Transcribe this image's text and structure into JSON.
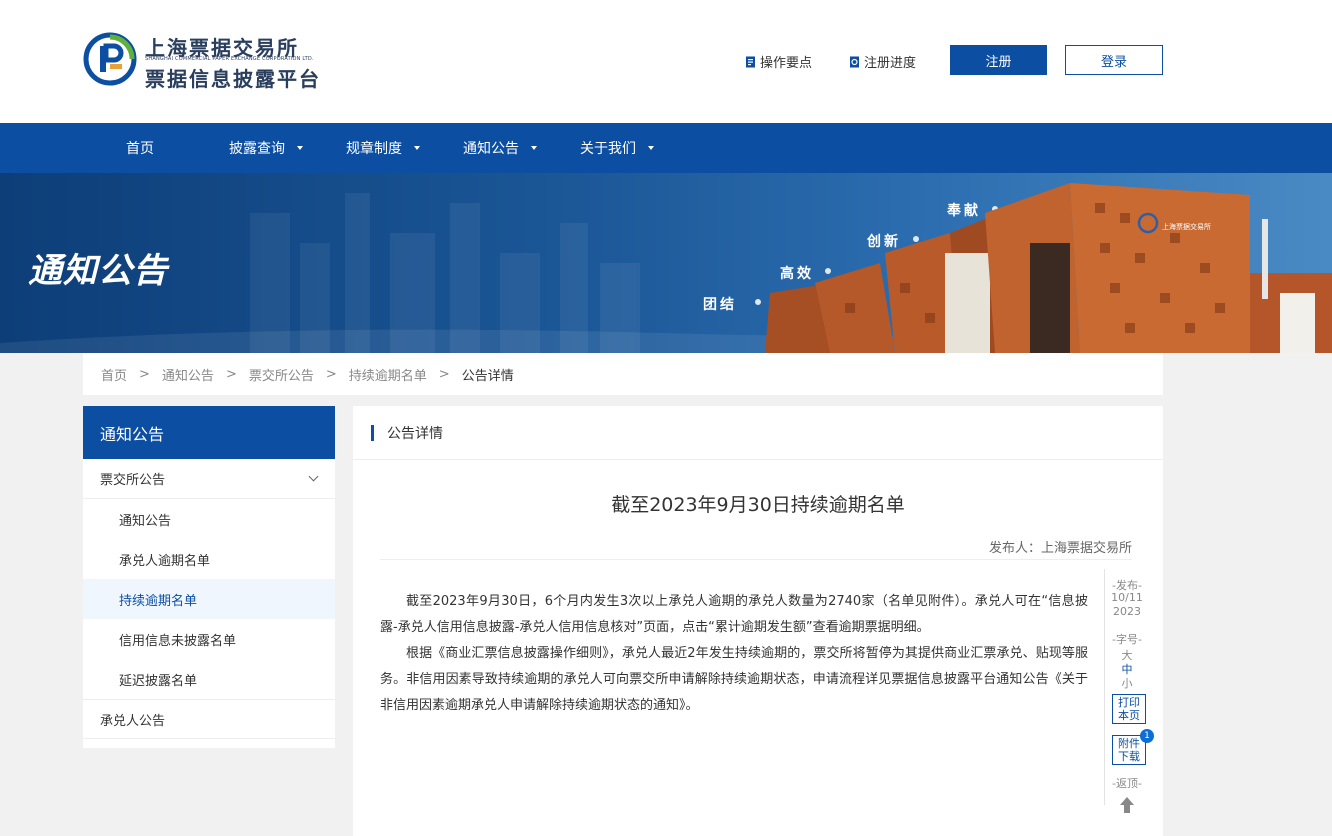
{
  "header": {
    "logo": {
      "title": "上海票据交易所",
      "subtitle_en": "SHANGHAI COMMERCIAL PAPER EXCHANGE CORPORATION LTD.",
      "platform": "票据信息披露平台"
    },
    "links": [
      {
        "label": "操作要点",
        "icon": "document-icon"
      },
      {
        "label": "注册进度",
        "icon": "progress-icon"
      }
    ],
    "register_label": "注册",
    "login_label": "登录"
  },
  "nav": {
    "items": [
      {
        "label": "首页",
        "has_dropdown": false
      },
      {
        "label": "披露查询",
        "has_dropdown": true
      },
      {
        "label": "规章制度",
        "has_dropdown": true
      },
      {
        "label": "通知公告",
        "has_dropdown": true
      },
      {
        "label": "关于我们",
        "has_dropdown": true
      }
    ]
  },
  "banner": {
    "title": "通知公告",
    "words": [
      "团结",
      "高效",
      "创新",
      "奉献"
    ],
    "building_sign": "上海票据交易所"
  },
  "breadcrumb": {
    "items": [
      "首页",
      "通知公告",
      "票交所公告",
      "持续逾期名单",
      "公告详情"
    ],
    "separator": ">"
  },
  "sidebar": {
    "title": "通知公告",
    "category": "票交所公告",
    "items": [
      {
        "label": "通知公告",
        "active": false
      },
      {
        "label": "承兑人逾期名单",
        "active": false
      },
      {
        "label": "持续逾期名单",
        "active": true
      },
      {
        "label": "信用信息未披露名单",
        "active": false
      },
      {
        "label": "延迟披露名单",
        "active": false
      }
    ],
    "category2": "承兑人公告"
  },
  "main": {
    "section_title": "公告详情",
    "article_title": "截至2023年9月30日持续逾期名单",
    "publisher": "发布人：上海票据交易所",
    "paragraphs": [
      "截至2023年9月30日，6个月内发生3次以上承兑人逾期的承兑人数量为2740家（名单见附件）。承兑人可在“信息披露-承兑人信用信息披露-承兑人信用信息核对”页面，点击“累计逾期发生额”查看逾期票据明细。",
      "根据《商业汇票信息披露操作细则》，承兑人最近2年发生持续逾期的，票交所将暂停为其提供商业汇票承兑、贴现等服务。非信用因素导致持续逾期的承兑人可向票交所申请解除持续逾期状态，申请流程详见票据信息披露平台通知公告《关于非信用因素逾期承兑人申请解除持续逾期状态的通知》。"
    ]
  },
  "toolbar": {
    "publish_label": "-发布-",
    "publish_date": "10/11",
    "publish_year": "2023",
    "font_label": "-字号-",
    "font_sizes": [
      "大",
      "中",
      "小"
    ],
    "font_active": "中",
    "print_label": "打印本页",
    "download_label": "附件下载",
    "attachment_count": "1",
    "back_label": "-返顶-"
  },
  "colors": {
    "brand_blue": "#0b4ea2",
    "banner_dark": "#0d3e78",
    "page_bg": "#f1f1f1",
    "building_rust": "#b95a2a",
    "logo_green": "#5fb13b"
  }
}
